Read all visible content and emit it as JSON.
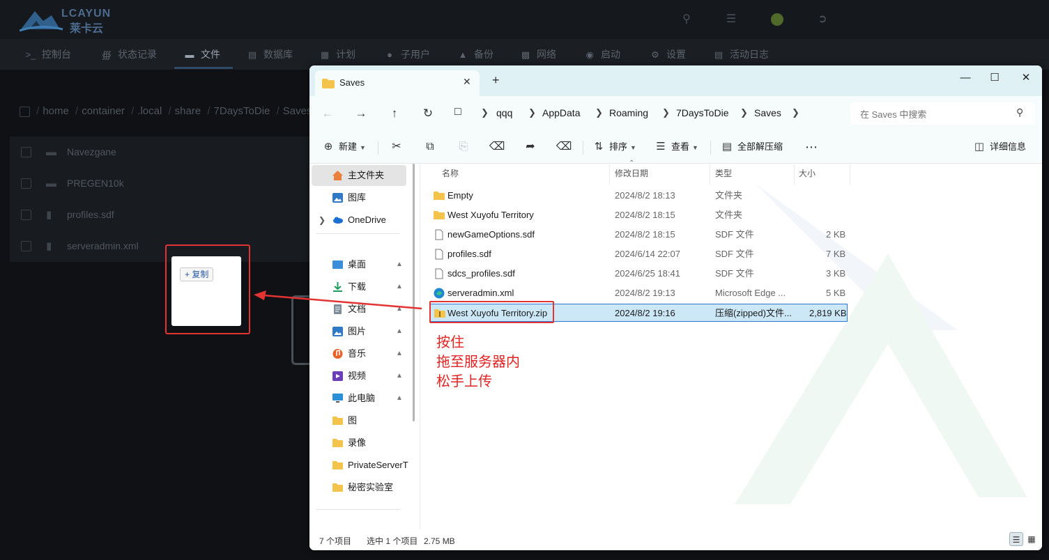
{
  "panel": {
    "logo_name": "LCAYUN",
    "logo_cn": "莱卡云",
    "nav": [
      {
        "label": "控制台",
        "icon": "terminal-icon"
      },
      {
        "label": "状态记录",
        "icon": "chart-icon"
      },
      {
        "label": "文件",
        "icon": "folder-icon",
        "active": true
      },
      {
        "label": "数据库",
        "icon": "database-icon"
      },
      {
        "label": "计划",
        "icon": "calendar-icon"
      },
      {
        "label": "子用户",
        "icon": "users-icon"
      },
      {
        "label": "备份",
        "icon": "upload-icon"
      },
      {
        "label": "网络",
        "icon": "network-icon"
      },
      {
        "label": "启动",
        "icon": "play-icon"
      },
      {
        "label": "设置",
        "icon": "gear-icon"
      },
      {
        "label": "活动日志",
        "icon": "log-icon"
      }
    ],
    "breadcrumb": [
      "home",
      "container",
      ".local",
      "share",
      "7DaysToDie",
      "Saves"
    ],
    "files": [
      {
        "name": "Navezgane",
        "type": "folder"
      },
      {
        "name": "PREGEN10k",
        "type": "folder"
      },
      {
        "name": "profiles.sdf",
        "type": "file"
      },
      {
        "name": "serveradmin.xml",
        "type": "file"
      }
    ],
    "copy_badge": "+ 复制"
  },
  "explorer": {
    "tab_title": "Saves",
    "address": [
      "qqq",
      "AppData",
      "Roaming",
      "7DaysToDie",
      "Saves"
    ],
    "search_placeholder": "在 Saves 中搜索",
    "toolbar": {
      "new": "新建",
      "sort": "排序",
      "view": "查看",
      "extract_all": "全部解压缩",
      "details": "详细信息"
    },
    "navpane": [
      {
        "label": "主文件夹",
        "icon": "home-icon",
        "selected": true
      },
      {
        "label": "图库",
        "icon": "gallery-icon"
      },
      {
        "label": "OneDrive",
        "icon": "cloud-icon",
        "expandable": true
      },
      {
        "label": "桌面",
        "icon": "desktop-icon",
        "pinned": true
      },
      {
        "label": "下载",
        "icon": "download-icon",
        "pinned": true
      },
      {
        "label": "文档",
        "icon": "document-icon",
        "pinned": true
      },
      {
        "label": "图片",
        "icon": "picture-icon",
        "pinned": true
      },
      {
        "label": "音乐",
        "icon": "music-icon",
        "pinned": true
      },
      {
        "label": "视频",
        "icon": "video-icon",
        "pinned": true
      },
      {
        "label": "此电脑",
        "icon": "computer-icon",
        "pinned": true
      },
      {
        "label": "图",
        "icon": "folder-icon"
      },
      {
        "label": "录像",
        "icon": "folder-icon"
      },
      {
        "label": "PrivateServerT",
        "icon": "folder-icon"
      },
      {
        "label": "秘密实验室",
        "icon": "folder-icon"
      }
    ],
    "columns": [
      "名称",
      "修改日期",
      "类型",
      "大小"
    ],
    "rows": [
      {
        "name": "Empty",
        "date": "2024/8/2 18:13",
        "type": "文件夹",
        "size": "",
        "icon": "folder"
      },
      {
        "name": "West Xuyofu Territory",
        "date": "2024/8/2 18:15",
        "type": "文件夹",
        "size": "",
        "icon": "folder"
      },
      {
        "name": "newGameOptions.sdf",
        "date": "2024/8/2 18:15",
        "type": "SDF 文件",
        "size": "2 KB",
        "icon": "file"
      },
      {
        "name": "profiles.sdf",
        "date": "2024/6/14 22:07",
        "type": "SDF 文件",
        "size": "7 KB",
        "icon": "file"
      },
      {
        "name": "sdcs_profiles.sdf",
        "date": "2024/6/25 18:41",
        "type": "SDF 文件",
        "size": "3 KB",
        "icon": "file"
      },
      {
        "name": "serveradmin.xml",
        "date": "2024/8/2 19:13",
        "type": "Microsoft Edge ...",
        "size": "5 KB",
        "icon": "edge"
      },
      {
        "name": "West Xuyofu Territory.zip",
        "date": "2024/8/2 19:16",
        "type": "压缩(zipped)文件...",
        "size": "2,819 KB",
        "icon": "zip",
        "selected": true
      }
    ],
    "annotation": [
      "按住",
      "拖至服务器内",
      "松手上传"
    ],
    "status": {
      "count": "7 个项目",
      "selected": "选中 1 个项目",
      "size": "2.75 MB"
    }
  },
  "colors": {
    "accent_red": "#e33333",
    "selection": "#cce8f7",
    "selection_border": "#2b78d4"
  }
}
